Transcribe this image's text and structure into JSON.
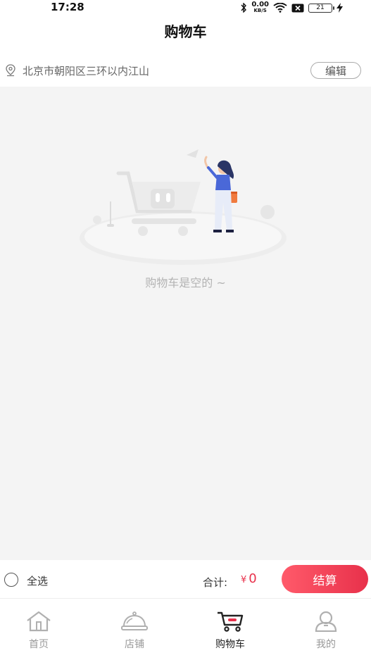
{
  "status_bar": {
    "time": "17:28",
    "net_speed_value": "0.00",
    "net_speed_unit": "KB/S",
    "battery": "21",
    "icons": [
      "bluetooth-icon",
      "wifi-icon",
      "sim-x-icon",
      "battery-icon",
      "charging-icon"
    ]
  },
  "header": {
    "title": "购物车"
  },
  "address": {
    "text": "北京市朝阳区三环以内江山",
    "edit_label": "编辑"
  },
  "empty_state": {
    "message": "购物车是空的 ~"
  },
  "checkout": {
    "select_all_label": "全选",
    "total_label": "合计:",
    "currency": "¥",
    "total_value": "0",
    "checkout_label": "结算"
  },
  "tabs": [
    {
      "label": "首页",
      "icon": "home-icon",
      "active": false
    },
    {
      "label": "店铺",
      "icon": "store-bell-icon",
      "active": false
    },
    {
      "label": "购物车",
      "icon": "cart-icon",
      "active": true
    },
    {
      "label": "我的",
      "icon": "profile-icon",
      "active": false
    }
  ],
  "colors": {
    "accent": "#e8314b",
    "background": "#f4f4f4",
    "muted_text": "#b3b3b3"
  }
}
